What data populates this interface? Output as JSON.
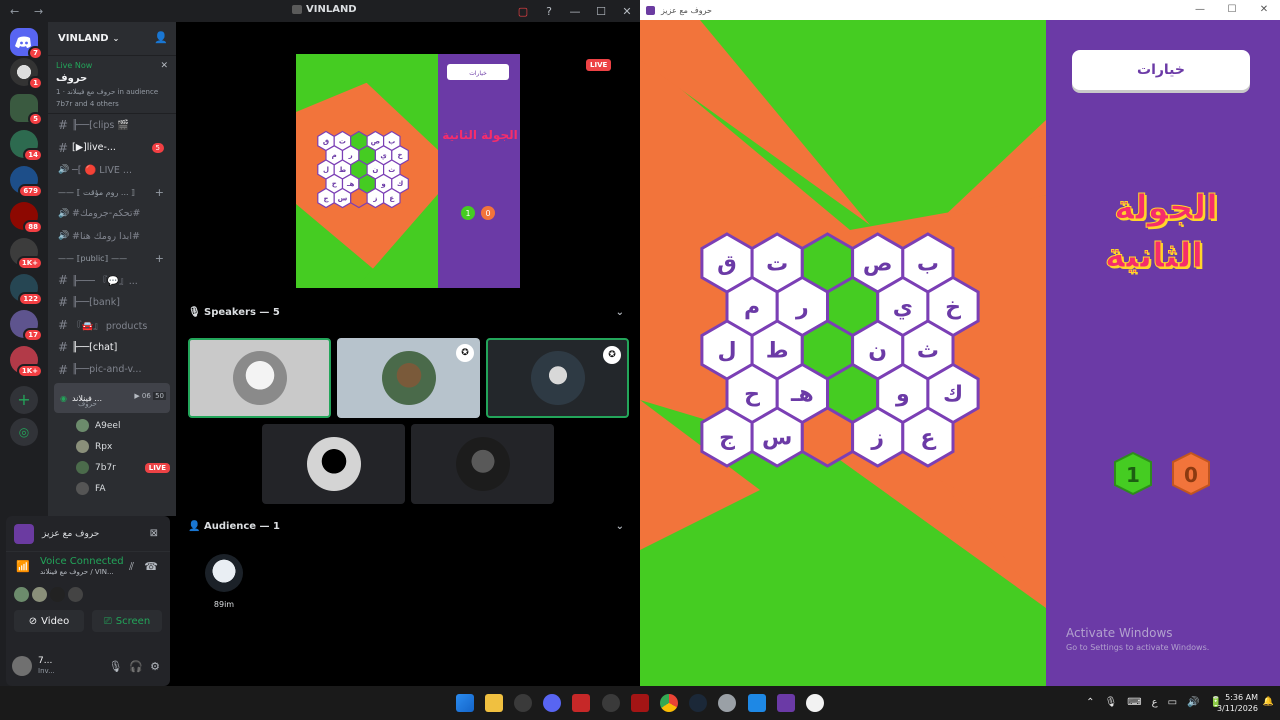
{
  "discord": {
    "window_title": "VINLAND",
    "nav_back": "←",
    "nav_forward": "→",
    "title_controls": [
      "▢",
      "?",
      "—",
      "☐",
      "✕"
    ],
    "server_name": "VINLAND",
    "server_badges": [
      "7",
      "1",
      "5",
      "14",
      "679",
      "88",
      "1K+",
      "122",
      "17",
      "1K+"
    ],
    "live_card": {
      "status": "Live Now",
      "name": "حروف",
      "host": "حروف مع فينلاند",
      "audience": "1 in audience",
      "others": "7b7r and 4 others"
    },
    "channels": [
      {
        "name": "╟──[clips 🎬",
        "bright": false
      },
      {
        "name": "[▶︎]live-...",
        "bright": true,
        "badge": "5"
      },
      {
        "name": "─[ 🔴 LIVE ...",
        "bright": false,
        "voice": true
      },
      {
        "category": "—— ⟦ روم مؤقت ... ⟧",
        "plus": true
      },
      {
        "name": "#تحكم-جرومك#",
        "bright": false,
        "voice": true
      },
      {
        "name": "#ابدا رومك هنا#",
        "bright": false,
        "voice": true
      },
      {
        "category": "—— ⟦public⟧ ——",
        "plus": true
      },
      {
        "name": "╟─── 『💬』...",
        "bright": false
      },
      {
        "name": "╟──[bank]",
        "bright": false
      },
      {
        "name": "『🚘』 products",
        "bright": false
      },
      {
        "name": "╟──[chat]",
        "bright": true
      },
      {
        "name": "╟──pic-and-v...",
        "bright": false
      }
    ],
    "voice_channel": {
      "name": "فينلاند ...",
      "sub": "حروف",
      "count_a": "06",
      "count_b": "50"
    },
    "voice_users": [
      {
        "name": "A9eel",
        "live": false
      },
      {
        "name": "Rpx",
        "live": false
      },
      {
        "name": "7b7r",
        "live": true,
        "live_label": "LIVE"
      },
      {
        "name": "FA",
        "live": false
      }
    ],
    "activity": "حروف مع عزيز",
    "voice_connected": "Voice Connected",
    "voice_sub": "حروف مع فينلاند / VIN...",
    "video_label": "Video",
    "screen_label": "Screen",
    "me_name": "7...",
    "me_status": "Inv...",
    "stage": {
      "live_label": "LIVE",
      "speakers_label": "Speakers — 5",
      "audience_label": "Audience — 1",
      "audience_user": "89im",
      "mini_options": "خيارات",
      "mini_round": "الجولة الثانية",
      "mini_score_a": "1",
      "mini_score_b": "0"
    }
  },
  "game": {
    "window_title": "حروف مع عزيز",
    "options_label": "خيارات",
    "round_title_1": "الجولة",
    "round_title_2": "الثانية",
    "score_green": "1",
    "score_orange": "0",
    "board": [
      [
        "ق",
        "ت",
        "",
        "ص",
        "ب"
      ],
      [
        "م",
        "ر",
        "",
        "ي",
        "خ"
      ],
      [
        "ل",
        "ط",
        "",
        "ن",
        "ث"
      ],
      [
        "ح",
        "هـ",
        "",
        "و",
        "ك"
      ],
      [
        "ج",
        "س",
        "",
        "ز",
        "ع"
      ]
    ],
    "green_cells": [
      [
        0,
        2
      ],
      [
        1,
        2
      ],
      [
        2,
        2
      ],
      [
        3,
        2
      ]
    ],
    "orange_cells": [
      [
        4,
        2
      ]
    ],
    "activate_1": "Activate Windows",
    "activate_2": "Go to Settings to activate Windows.",
    "colors": {
      "green": "#45cc22",
      "orange": "#f2743b",
      "purple": "#6b3aa6",
      "hex_stroke": "#7b3fb5"
    }
  },
  "taskbar": {
    "time": "5:36 AM",
    "date": "3/11/2026",
    "tray": [
      "⌃",
      "🎙",
      "⌨",
      "ع",
      "▭",
      "🔊",
      "🔋"
    ]
  }
}
